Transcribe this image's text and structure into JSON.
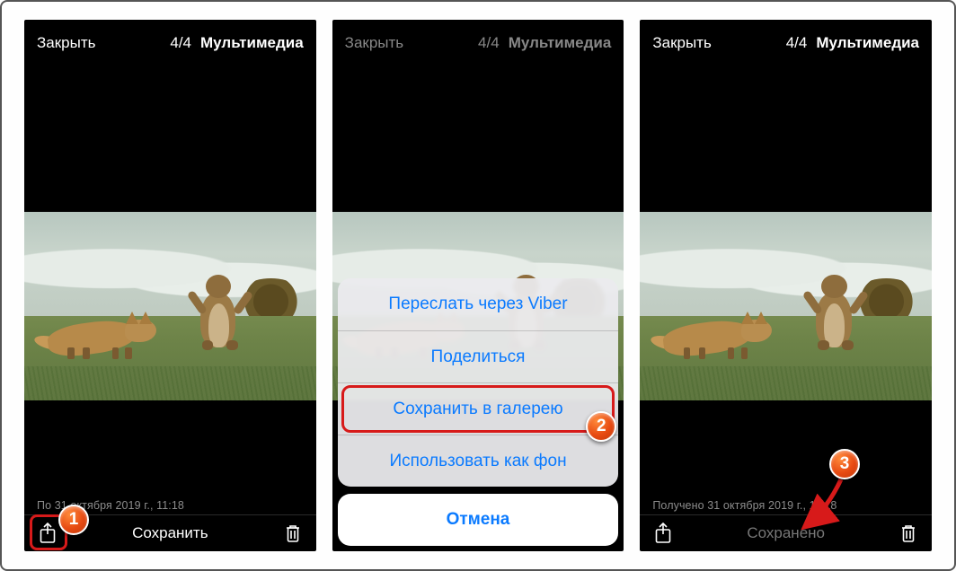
{
  "top": {
    "close": "Закрыть",
    "counter": "4/4",
    "media": "Мультимедиа"
  },
  "footer": {
    "timestamp_full": "Получено 31 октября 2019 г., 11:18",
    "timestamp_partial": "По          31 октября 2019 г., 11:18",
    "save": "Сохранить",
    "saved": "Сохранено"
  },
  "sheet": {
    "forward": "Переслать через Viber",
    "share": "Поделиться",
    "save_gallery": "Сохранить в галерею",
    "use_bg": "Использовать как фон",
    "cancel": "Отмена"
  },
  "badges": {
    "b1": "1",
    "b2": "2",
    "b3": "3"
  },
  "icons": {
    "share": "share-icon",
    "trash": "trash-icon"
  }
}
